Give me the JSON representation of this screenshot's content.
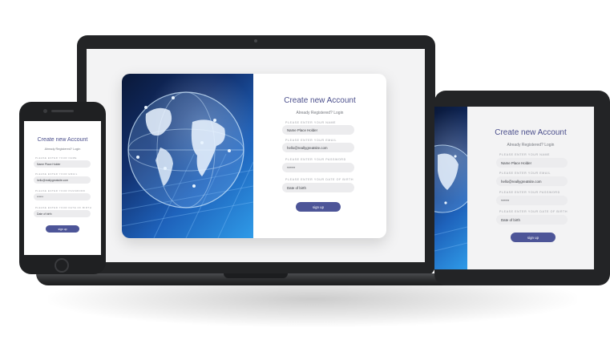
{
  "form": {
    "title": "Create new Account",
    "subtitle": "Already Registered? Login",
    "fields": [
      {
        "label": "Please enter your name",
        "value": "Name Place Holder"
      },
      {
        "label": "Please enter your email",
        "value": "hello@reallygreatsite.com"
      },
      {
        "label": "Please enter your password",
        "value": "******"
      },
      {
        "label": "Please enter your date of birth",
        "value": "Date of birth"
      }
    ],
    "button": "sign up"
  },
  "colors": {
    "accent": "#4d5598",
    "title": "#4b4f8c",
    "device": "#232426",
    "field": "#ececee"
  },
  "icons": [
    "globe-image"
  ]
}
